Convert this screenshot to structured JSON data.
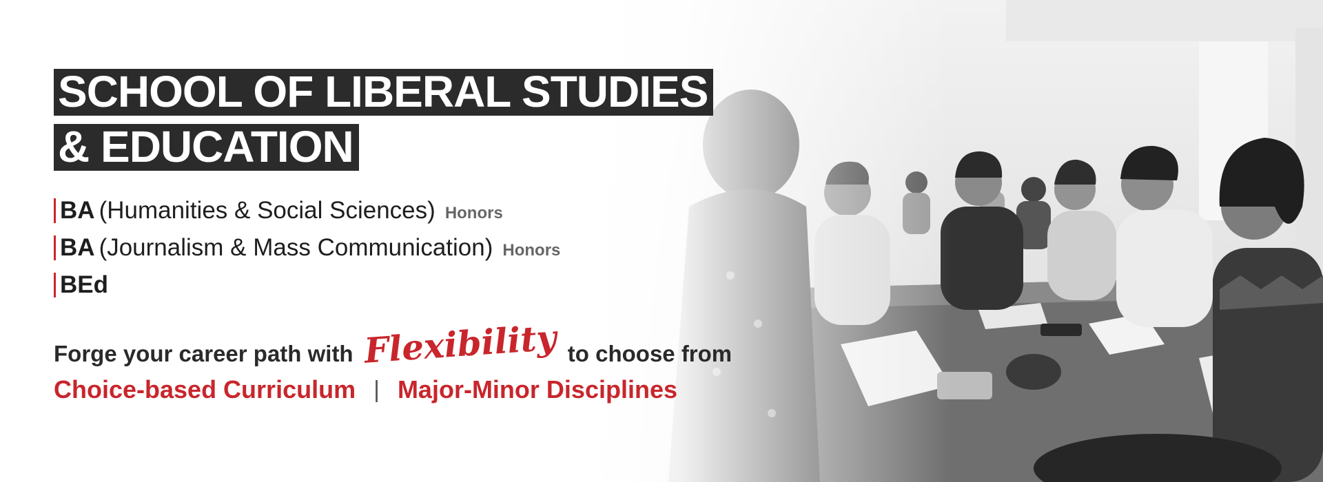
{
  "title": {
    "line1": "SCHOOL OF LIBERAL STUDIES",
    "line2": "& EDUCATION"
  },
  "programs": [
    {
      "name": "BA",
      "desc": "(Humanities & Social Sciences)",
      "tag": "Honors"
    },
    {
      "name": "BA",
      "desc": "(Journalism & Mass Communication)",
      "tag": "Honors"
    },
    {
      "name": "BEd",
      "desc": "",
      "tag": ""
    }
  ],
  "tagline": {
    "before": "Forge your career path with",
    "highlight": "Flexibility",
    "after": "to choose from"
  },
  "choices": {
    "left": "Choice-based Curriculum",
    "separator": "|",
    "right": "Major-Minor Disciplines"
  },
  "colors": {
    "accent": "#c8262c",
    "title_bg": "#2b2b2b"
  }
}
